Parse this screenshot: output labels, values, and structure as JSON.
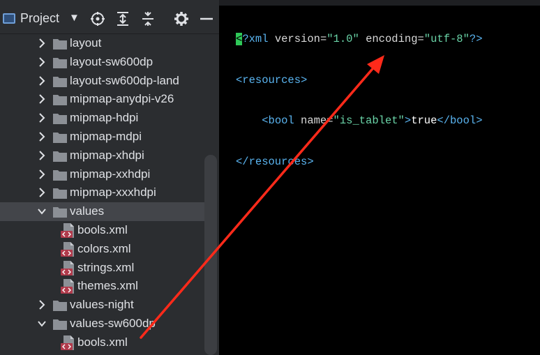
{
  "project_panel": {
    "title": "Project",
    "caret": "▼",
    "toolbar_icons": [
      "crosshair-icon",
      "expand-all-icon",
      "collapse-all-icon",
      "gear-icon",
      "minimize-icon"
    ]
  },
  "tree": {
    "items": [
      {
        "label": "layout",
        "type": "folder",
        "expanded": false
      },
      {
        "label": "layout-sw600dp",
        "type": "folder",
        "expanded": false
      },
      {
        "label": "layout-sw600dp-land",
        "type": "folder",
        "expanded": false
      },
      {
        "label": "mipmap-anydpi-v26",
        "type": "folder",
        "expanded": false
      },
      {
        "label": "mipmap-hdpi",
        "type": "folder",
        "expanded": false
      },
      {
        "label": "mipmap-mdpi",
        "type": "folder",
        "expanded": false
      },
      {
        "label": "mipmap-xhdpi",
        "type": "folder",
        "expanded": false
      },
      {
        "label": "mipmap-xxhdpi",
        "type": "folder",
        "expanded": false
      },
      {
        "label": "mipmap-xxxhdpi",
        "type": "folder",
        "expanded": false
      },
      {
        "label": "values",
        "type": "folder",
        "expanded": true,
        "selected": true
      },
      {
        "label": "bools.xml",
        "type": "file"
      },
      {
        "label": "colors.xml",
        "type": "file"
      },
      {
        "label": "strings.xml",
        "type": "file"
      },
      {
        "label": "themes.xml",
        "type": "file"
      },
      {
        "label": "values-night",
        "type": "folder",
        "expanded": false
      },
      {
        "label": "values-sw600dp",
        "type": "folder",
        "expanded": true
      },
      {
        "label": "bools.xml",
        "type": "file"
      }
    ]
  },
  "editor": {
    "lines": [
      {
        "cursor": "<",
        "decl_open": "?xml ",
        "attr1": "version=",
        "val1": "\"1.0\"",
        "sp": " ",
        "attr2": "encoding=",
        "val2": "\"utf-8\"",
        "decl_close": "?>"
      },
      {
        "tag": "<resources>"
      },
      {
        "indent": "    ",
        "tag_open": "<bool ",
        "attr": "name=",
        "val": "\"is_tablet\"",
        "tag_mid": ">",
        "text": "true",
        "tag_close": "</bool>"
      },
      {
        "tag": "</resources>"
      }
    ]
  },
  "colors": {
    "panel_bg": "#2b2d30",
    "editor_bg": "#000000",
    "selection": "#43454a",
    "arrow": "#ff2a1a",
    "xml_tag": "#5ab4f0",
    "xml_string": "#6ad4a8",
    "cursor": "#2fc858"
  }
}
